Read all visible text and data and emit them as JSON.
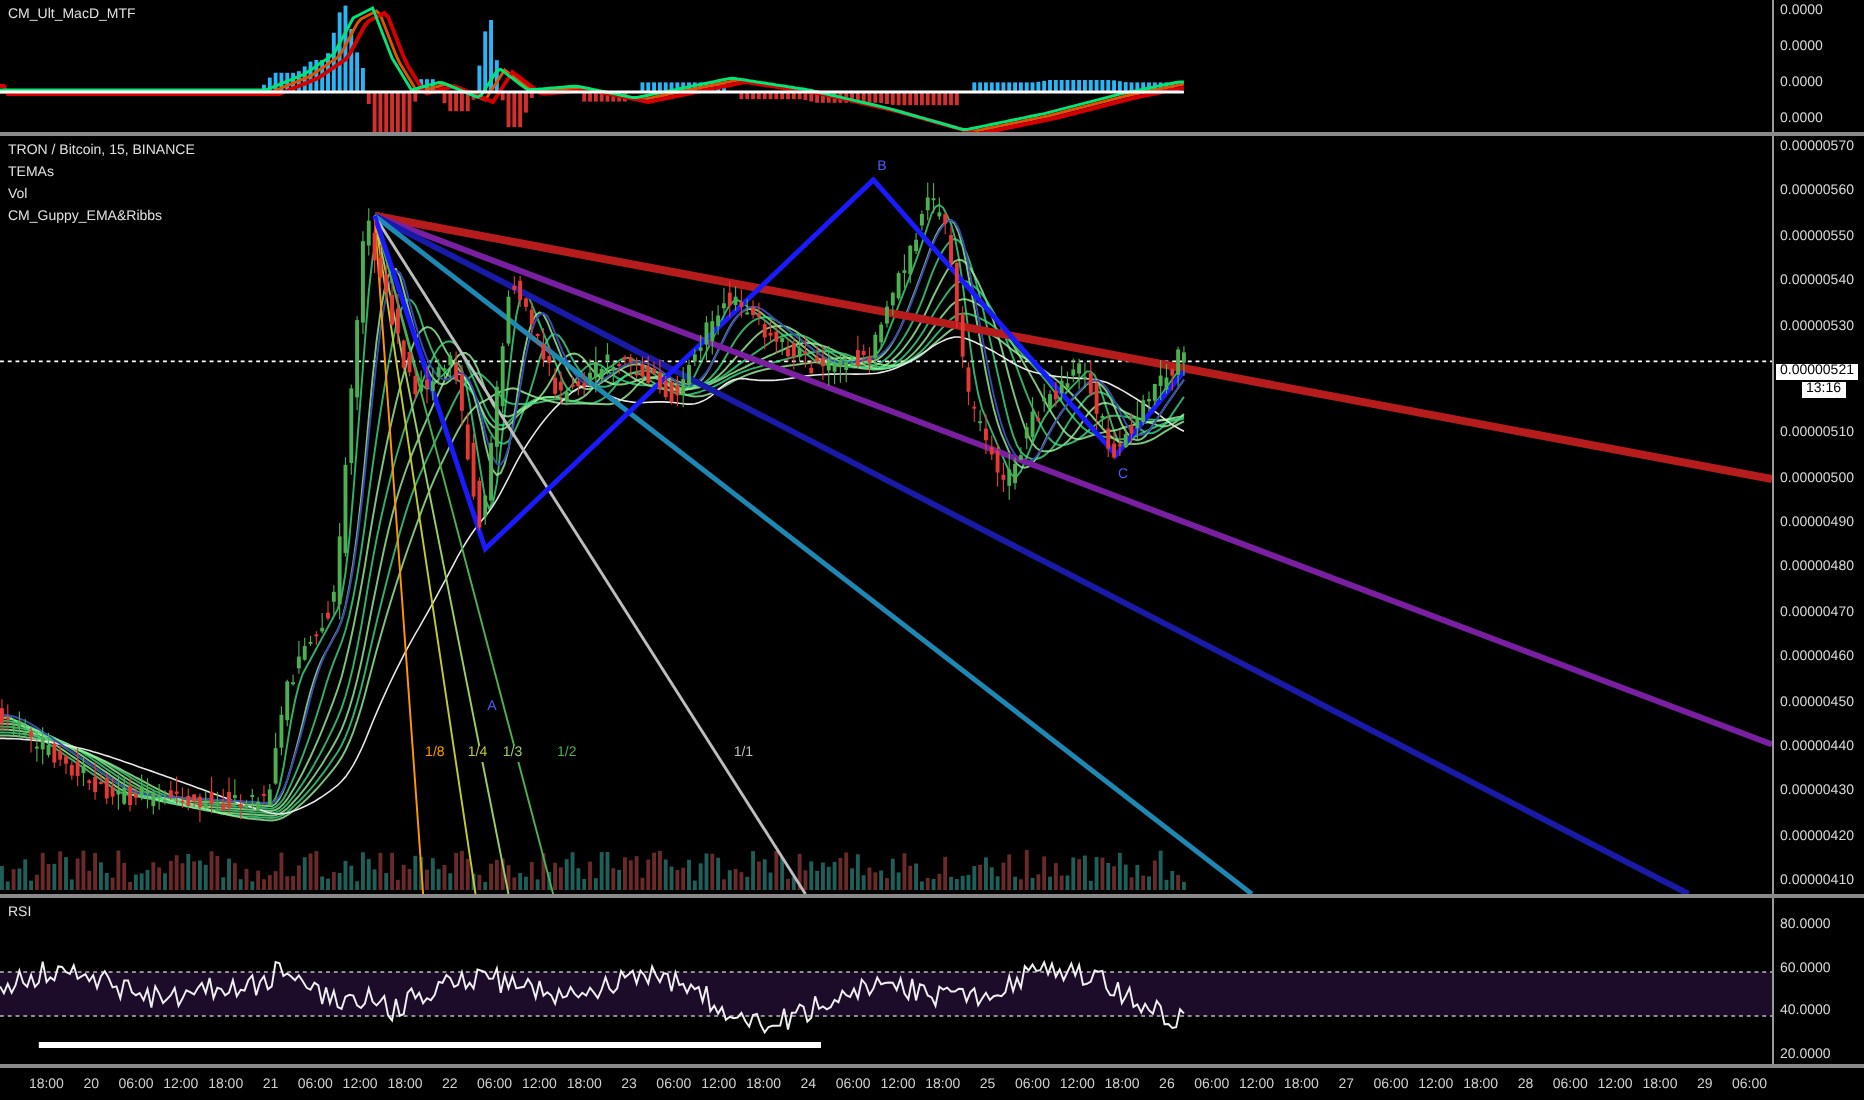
{
  "macd_pane": {
    "title": "CM_Ult_MacD_MTF",
    "axis_labels": [
      "0.0000",
      "0.0000",
      "0.0000",
      "0.0000"
    ]
  },
  "price_pane": {
    "legend": [
      "TRON / Bitcoin, 15, BINANCE",
      "TEMAs",
      "Vol",
      "CM_Guppy_EMA&Ribbs"
    ],
    "ticks": [
      {
        "kind": "tick",
        "label": "0.00000570"
      },
      {
        "kind": "tick",
        "label": "0.00000560"
      },
      {
        "kind": "tick",
        "label": "0.00000550"
      },
      {
        "kind": "tick",
        "label": "0.00000540"
      },
      {
        "kind": "tick",
        "label": "0.00000530"
      },
      {
        "kind": "last_price",
        "label": "0.00000521",
        "countdown": "13:16"
      },
      {
        "kind": "tick",
        "label": "0.00000510"
      },
      {
        "kind": "tick",
        "label": "0.00000500"
      },
      {
        "kind": "tick",
        "label": "0.00000490"
      },
      {
        "kind": "tick",
        "label": "0.00000480"
      },
      {
        "kind": "tick",
        "label": "0.00000470"
      },
      {
        "kind": "tick",
        "label": "0.00000460"
      },
      {
        "kind": "tick",
        "label": "0.00000450"
      },
      {
        "kind": "tick",
        "label": "0.00000440"
      },
      {
        "kind": "tick",
        "label": "0.00000430"
      },
      {
        "kind": "tick",
        "label": "0.00000420"
      },
      {
        "kind": "tick",
        "label": "0.00000410"
      }
    ],
    "pattern_labels": [
      "A",
      "B",
      "C"
    ],
    "fan_labels": [
      "1/8",
      "1/4",
      "1/3",
      "1/2",
      "1/1"
    ]
  },
  "rsi_pane": {
    "title": "RSI",
    "axis_labels": [
      "80.0000",
      "60.0000",
      "40.0000",
      "20.0000"
    ]
  },
  "time_axis": {
    "labels": [
      "18:00",
      "20",
      "06:00",
      "12:00",
      "18:00",
      "21",
      "06:00",
      "12:00",
      "18:00",
      "22",
      "06:00",
      "12:00",
      "18:00",
      "23",
      "06:00",
      "12:00",
      "18:00",
      "24",
      "06:00",
      "12:00",
      "18:00",
      "25",
      "06:00",
      "12:00",
      "18:00",
      "26",
      "06:00",
      "12:00",
      "18:00",
      "27",
      "06:00",
      "12:00",
      "18:00",
      "28",
      "06:00",
      "12:00",
      "18:00",
      "29",
      "06:00"
    ]
  }
}
